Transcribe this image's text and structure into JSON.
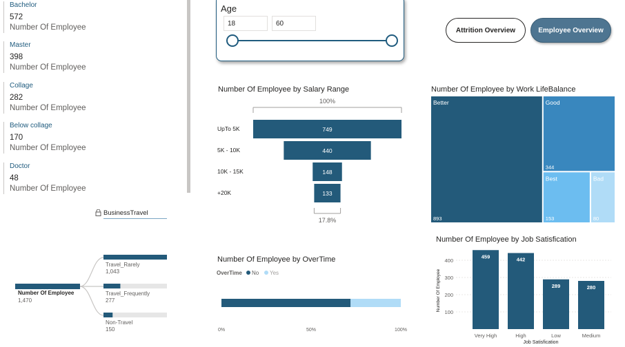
{
  "education": [
    {
      "category": "Bachelor",
      "value": "572",
      "label": "Number Of Employee"
    },
    {
      "category": "Master",
      "value": "398",
      "label": "Number Of Employee"
    },
    {
      "category": "Collage",
      "value": "282",
      "label": "Number Of Employee"
    },
    {
      "category": "Below collage",
      "value": "170",
      "label": "Number Of Employee"
    },
    {
      "category": "Doctor",
      "value": "48",
      "label": "Number Of Employee"
    }
  ],
  "age_slicer": {
    "title": "Age",
    "min": "18",
    "max": "60"
  },
  "nav": {
    "attrition": "Attrition Overview",
    "employee": "Employee Overview"
  },
  "funnel": {
    "title": "Number Of Employee by Salary Range",
    "top_pct": "100%",
    "bottom_pct": "17.8%",
    "chart_data": {
      "type": "bar",
      "categories": [
        "UpTo 5K",
        "5K - 10K",
        "10K - 15K",
        "+20K"
      ],
      "values": [
        749,
        440,
        148,
        133
      ]
    }
  },
  "treemap": {
    "title": "Number Of Employee by Work LifeBalance",
    "chart_data": {
      "type": "treemap",
      "categories": [
        "Better",
        "Good",
        "Best",
        "Bad"
      ],
      "values": [
        893,
        344,
        153,
        80
      ]
    }
  },
  "business_travel": {
    "slicer_label": "BusinessTravel",
    "root_label": "Number Of Employee",
    "root_value": "1,470",
    "chart_data": {
      "type": "bar",
      "categories": [
        "Travel_Rarely",
        "Travel_Frequently",
        "Non-Travel"
      ],
      "values": [
        1043,
        277,
        150
      ],
      "value_labels": [
        "1,043",
        "277",
        "150"
      ]
    }
  },
  "overtime": {
    "title": "Number Of Employee by OverTime",
    "legend_title": "OverTime",
    "chart_data": {
      "type": "bar",
      "series": [
        {
          "name": "No",
          "value": 0.72
        },
        {
          "name": "Yes",
          "value": 0.28
        }
      ],
      "ticks": [
        "0%",
        "50%",
        "100%"
      ]
    }
  },
  "job_satisfaction": {
    "title": "Number Of Employee by Job Satisfication",
    "chart_data": {
      "type": "bar",
      "categories": [
        "Very High",
        "High",
        "Low",
        "Medium"
      ],
      "values": [
        459,
        442,
        289,
        280
      ],
      "xlabel": "Job Satisfication",
      "ylabel": "Number Of Employee",
      "yticks": [
        100,
        200,
        300,
        400
      ],
      "ylim": [
        0,
        460
      ]
    }
  },
  "colors": {
    "dark": "#235a7a",
    "mid": "#3987be",
    "light": "#6cbdf0",
    "lighter": "#b0dcf7",
    "track": "#e6e6e6"
  }
}
